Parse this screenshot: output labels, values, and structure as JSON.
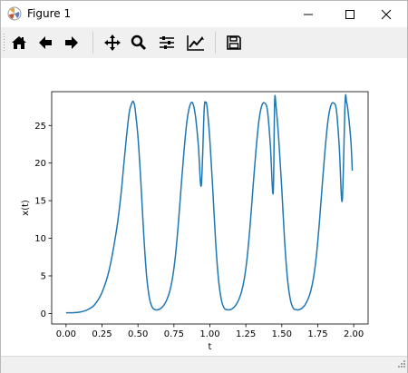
{
  "window": {
    "title": "Figure 1"
  },
  "toolbar": {
    "buttons": [
      {
        "name": "home-icon",
        "tooltip": "Home"
      },
      {
        "name": "back-arrow-icon",
        "tooltip": "Back"
      },
      {
        "name": "forward-arrow-icon",
        "tooltip": "Forward"
      },
      {
        "name": "pan-move-icon",
        "tooltip": "Pan"
      },
      {
        "name": "zoom-magnifier-icon",
        "tooltip": "Zoom"
      },
      {
        "name": "configure-subplots-icon",
        "tooltip": "Subplots"
      },
      {
        "name": "edit-axis-icon",
        "tooltip": "Customize"
      },
      {
        "name": "save-floppy-icon",
        "tooltip": "Save"
      }
    ]
  },
  "chart_data": {
    "type": "line",
    "xlabel": "t",
    "ylabel": "x(t)",
    "xlim": [
      -0.1,
      2.1
    ],
    "ylim": [
      -1.4,
      29.5
    ],
    "xticks": [
      "0.00",
      "0.25",
      "0.50",
      "0.75",
      "1.00",
      "1.25",
      "1.50",
      "1.75",
      "2.00"
    ],
    "yticks": [
      "0",
      "5",
      "10",
      "15",
      "20",
      "25"
    ],
    "grid": false,
    "line_color": "#1f77b4",
    "series": [
      {
        "x": [
          0.0,
          0.05,
          0.1,
          0.15,
          0.2,
          0.25,
          0.3,
          0.35,
          0.38,
          0.4,
          0.42,
          0.44,
          0.46,
          0.47,
          0.48,
          0.5,
          0.52,
          0.54,
          0.56,
          0.58,
          0.6,
          0.62,
          0.64,
          0.66,
          0.68,
          0.7,
          0.72,
          0.74,
          0.76,
          0.78,
          0.8,
          0.82,
          0.84,
          0.86,
          0.88,
          0.9,
          0.92,
          0.94,
          0.96,
          0.97,
          0.98,
          1.0,
          1.02,
          1.04,
          1.06,
          1.08,
          1.1,
          1.12,
          1.14,
          1.16,
          1.18,
          1.2,
          1.22,
          1.24,
          1.26,
          1.28,
          1.3,
          1.32,
          1.34,
          1.36,
          1.38,
          1.4,
          1.42,
          1.44,
          1.45,
          1.46,
          1.48,
          1.5,
          1.52,
          1.54,
          1.56,
          1.58,
          1.6,
          1.62,
          1.64,
          1.66,
          1.68,
          1.7,
          1.72,
          1.74,
          1.76,
          1.78,
          1.8,
          1.82,
          1.84,
          1.86,
          1.88,
          1.9,
          1.92,
          1.94,
          1.95,
          1.96,
          1.98,
          1.99
        ],
        "y": [
          0.1,
          0.1,
          0.2,
          0.5,
          1.2,
          2.8,
          5.8,
          11.0,
          15.5,
          19.5,
          23.5,
          26.8,
          28.1,
          28.1,
          27.2,
          23.5,
          17.5,
          10.5,
          5.0,
          2.0,
          0.8,
          0.5,
          0.5,
          0.7,
          1.1,
          1.8,
          2.9,
          4.7,
          7.6,
          11.8,
          16.8,
          21.6,
          25.5,
          27.6,
          28.0,
          26.2,
          22.3,
          17.0,
          27.0,
          28.0,
          27.5,
          23.0,
          16.5,
          9.5,
          4.5,
          1.8,
          0.7,
          0.5,
          0.5,
          0.7,
          1.1,
          1.8,
          2.9,
          4.7,
          7.6,
          11.8,
          16.8,
          21.6,
          25.5,
          27.6,
          28.0,
          27.0,
          22.5,
          16.0,
          28.1,
          27.5,
          22.8,
          16.5,
          9.5,
          4.5,
          1.8,
          0.7,
          0.5,
          0.5,
          0.7,
          1.1,
          1.8,
          2.9,
          4.7,
          7.6,
          11.8,
          16.8,
          21.6,
          25.5,
          27.6,
          28.0,
          27.0,
          22.0,
          15.0,
          28.1,
          28.1,
          27.0,
          23.0,
          19.0
        ]
      }
    ]
  }
}
